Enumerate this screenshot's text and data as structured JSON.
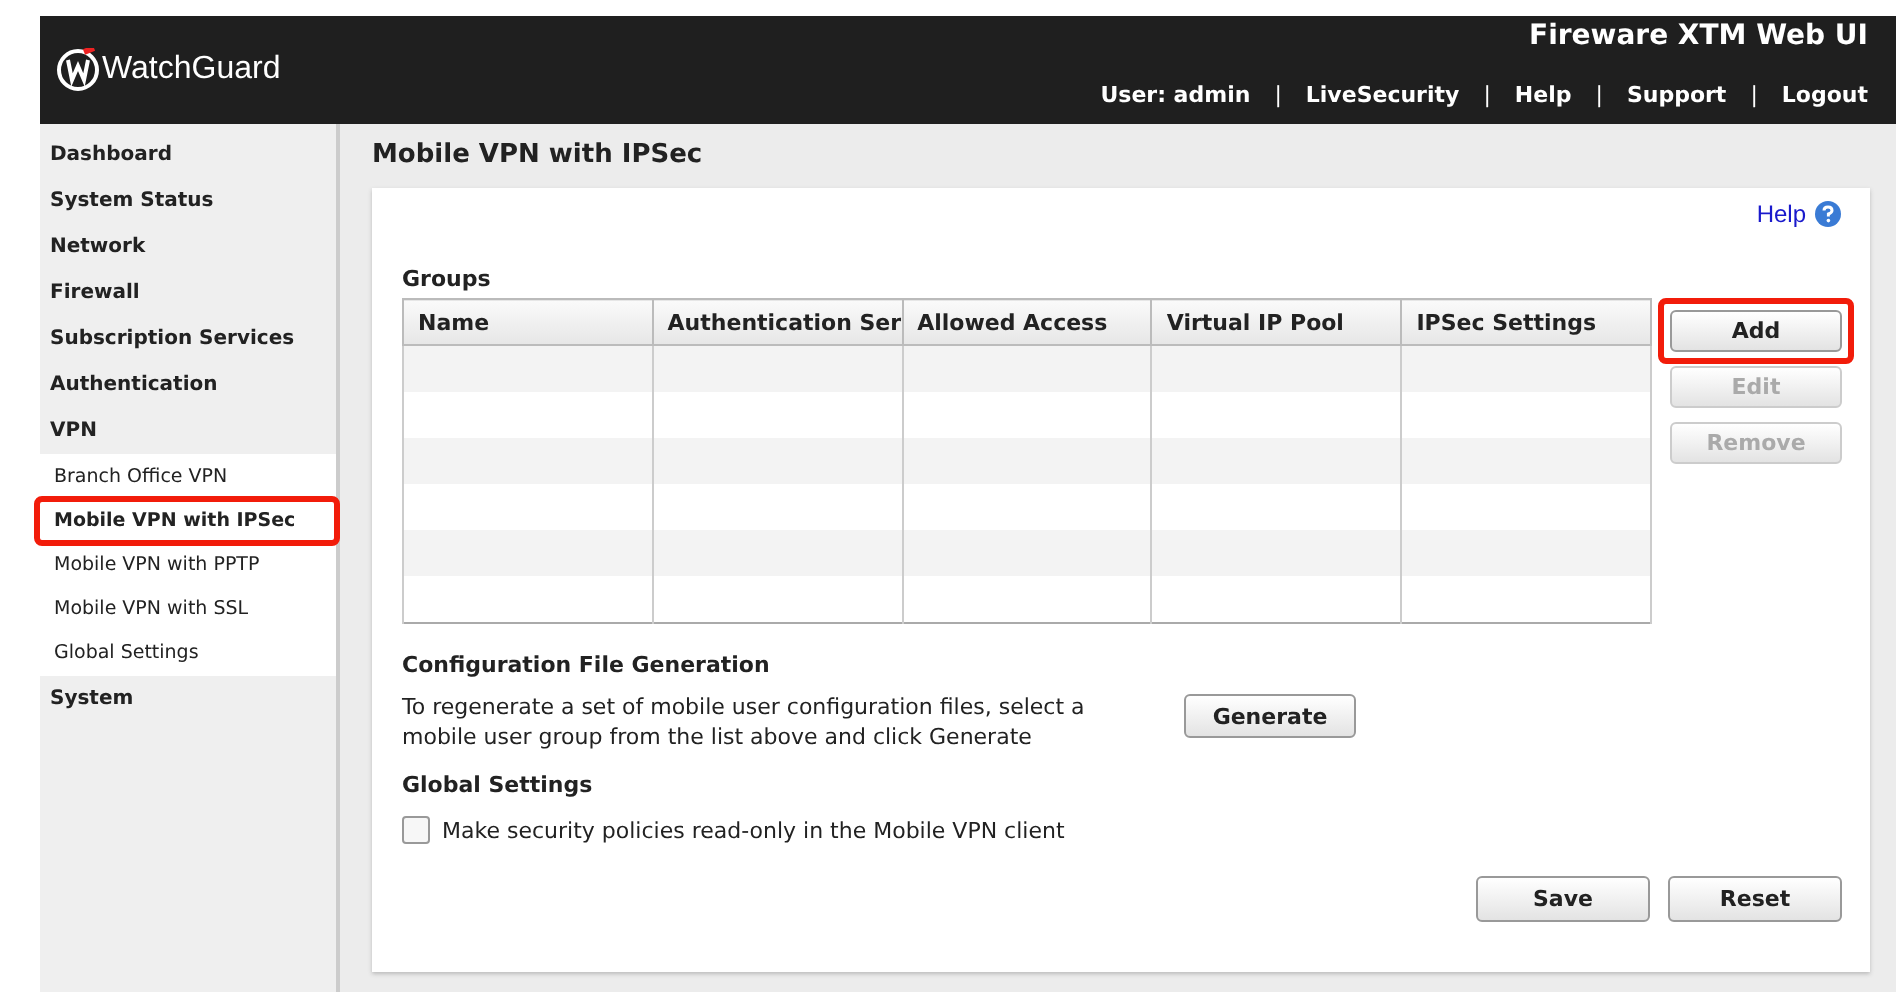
{
  "header": {
    "logo": "WatchGuard",
    "product": "Fireware XTM Web UI",
    "user": "User: admin",
    "links": [
      {
        "separator": "|",
        "label": "LiveSecurity"
      },
      {
        "separator": "|",
        "label": "Help"
      },
      {
        "separator": "|",
        "label": "Support"
      },
      {
        "separator": "|",
        "label": "Logout"
      }
    ]
  },
  "sidebar": {
    "items": [
      {
        "label": "Dashboard"
      },
      {
        "label": "System Status"
      },
      {
        "label": "Network"
      },
      {
        "label": "Firewall"
      },
      {
        "label": "Subscription Services"
      },
      {
        "label": "Authentication"
      },
      {
        "label": "VPN",
        "expanded": true,
        "children": [
          {
            "label": "Branch Office VPN",
            "selected": false,
            "highlighted": false
          },
          {
            "label": "Mobile VPN with IPSec",
            "selected": true,
            "highlighted": true
          },
          {
            "label": "Mobile VPN with PPTP",
            "selected": false,
            "highlighted": false
          },
          {
            "label": "Mobile VPN with SSL",
            "selected": false,
            "highlighted": false
          },
          {
            "label": "Global Settings",
            "selected": false,
            "highlighted": false
          }
        ]
      },
      {
        "label": "System"
      }
    ]
  },
  "page": {
    "title": "Mobile VPN with IPSec",
    "help": "Help",
    "groups": {
      "title": "Groups",
      "columns": [
        "Name",
        "Authentication Ser",
        "Allowed Access",
        "Virtual IP Pool",
        "IPSec Settings"
      ],
      "buttons": [
        {
          "label": "Add",
          "disabled": false,
          "highlighted": true
        },
        {
          "label": "Edit",
          "disabled": true,
          "highlighted": false
        },
        {
          "label": "Remove",
          "disabled": true,
          "highlighted": false
        }
      ]
    },
    "config": {
      "title": "Configuration File Generation",
      "text": "To regenerate a set of mobile user configuration files, select a mobile user group from the list above and click Generate",
      "button": "Generate"
    },
    "global": {
      "title": "Global Settings",
      "checkbox": {
        "label": "Make security policies read-only in the Mobile VPN client",
        "checked": false
      }
    },
    "buttons": [
      "Save",
      "Reset"
    ]
  }
}
